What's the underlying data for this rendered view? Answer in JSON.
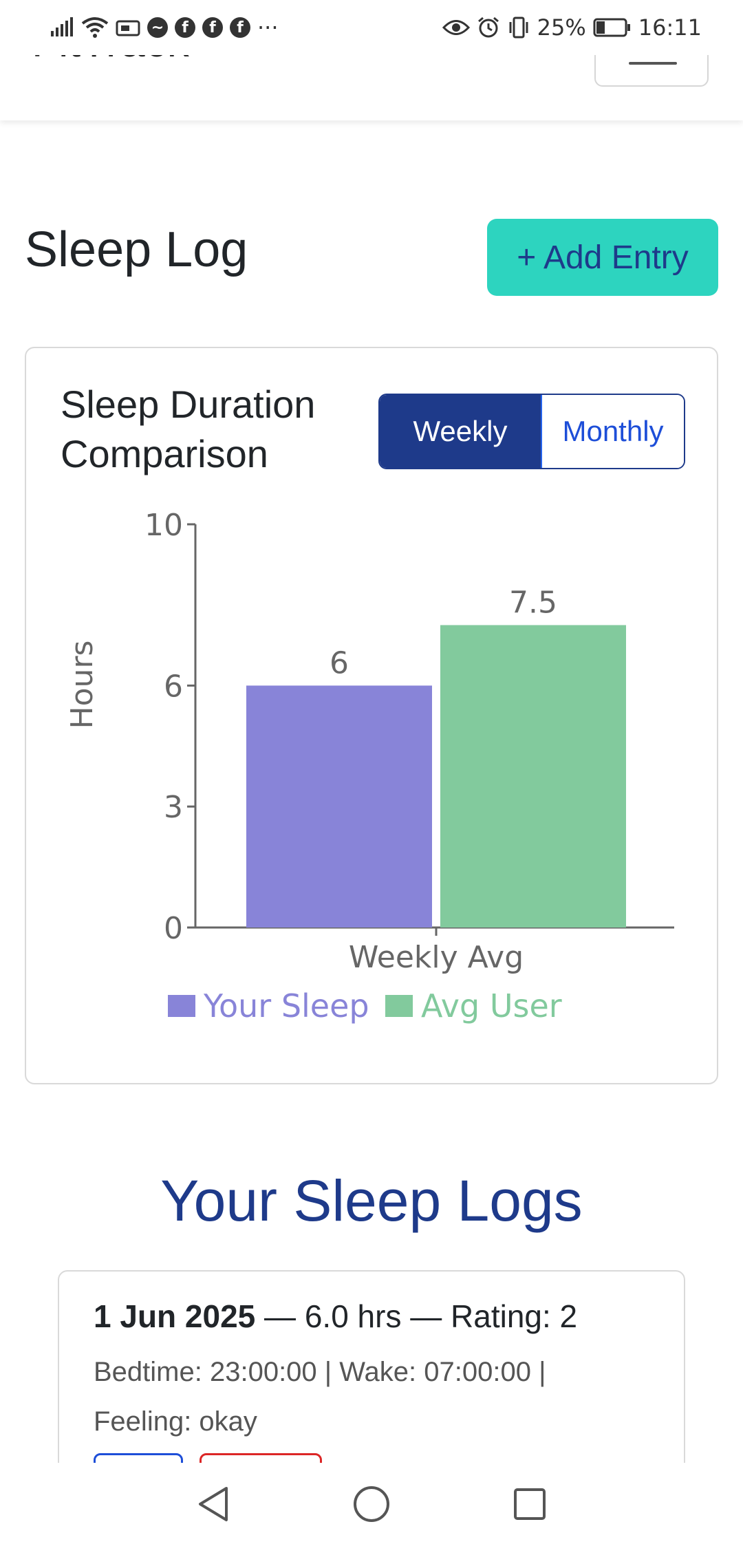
{
  "status_bar": {
    "time": "16:11",
    "battery": "25%",
    "more": "···"
  },
  "header": {
    "brand": "FitTrack"
  },
  "page": {
    "title": "Sleep Log",
    "add_button": "+ Add Entry"
  },
  "chart_card": {
    "title_line1": "Sleep Duration",
    "title_line2": "Comparison",
    "toggle": {
      "weekly": "Weekly",
      "monthly": "Monthly",
      "selected": "Weekly"
    }
  },
  "chart_data": {
    "type": "bar",
    "title": "Sleep Duration Comparison",
    "categories": [
      "Weekly Avg"
    ],
    "series": [
      {
        "name": "Your Sleep",
        "values": [
          6
        ],
        "color": "#8884d8"
      },
      {
        "name": "Avg User",
        "values": [
          7.5
        ],
        "color": "#82ca9d"
      }
    ],
    "data_labels": [
      "6",
      "7.5"
    ],
    "xlabel": "",
    "ylabel": "Hours",
    "ylim": [
      0,
      10
    ],
    "yticks": [
      "0",
      "3",
      "6",
      "10"
    ],
    "ytick_values": [
      0,
      3,
      6,
      10
    ],
    "legend_position": "bottom",
    "grid": false
  },
  "logs": {
    "title": "Your Sleep Logs",
    "entries": [
      {
        "date": "1 Jun 2025",
        "summary": " — 6.0 hrs — Rating: 2",
        "detail_line1": "Bedtime: 23:00:00 | Wake: 07:00:00 |",
        "detail_line2": "Feeling: okay"
      }
    ]
  },
  "colors": {
    "accent": "#2dd4bf",
    "primary": "#1e3a8a",
    "series_your_sleep": "#8884d8",
    "series_avg_user": "#82ca9d"
  }
}
